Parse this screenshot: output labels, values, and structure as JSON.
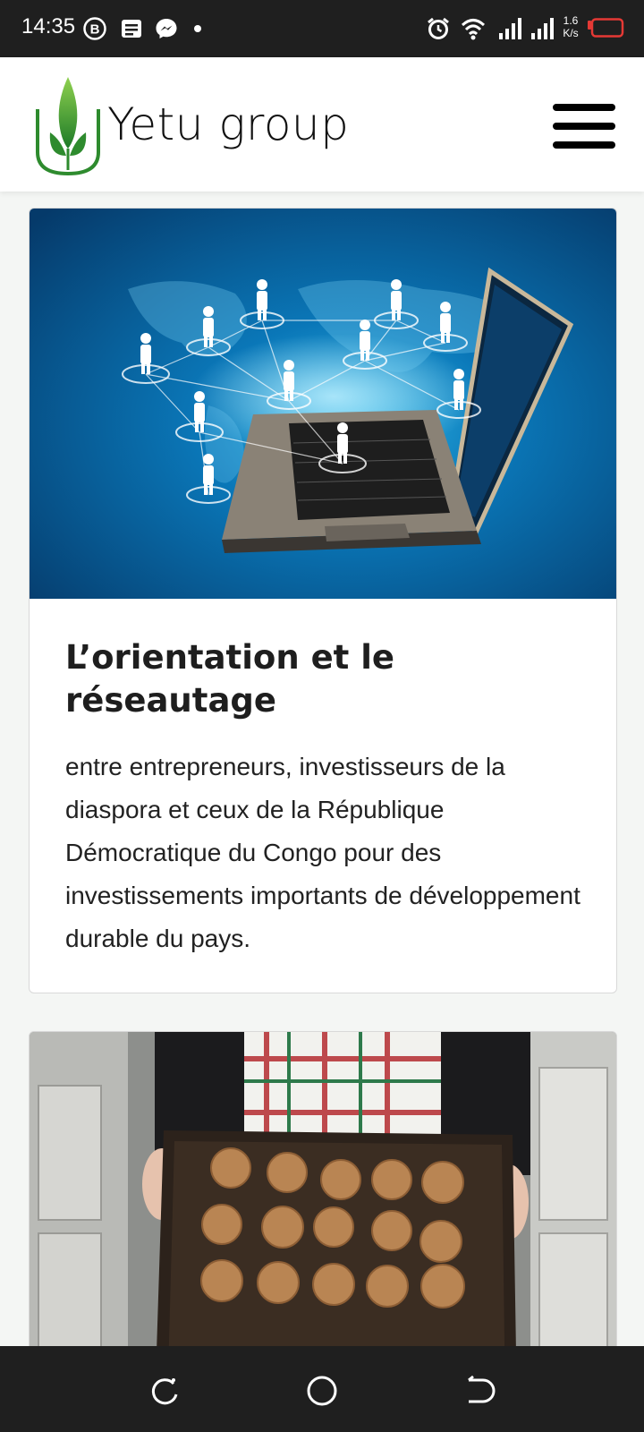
{
  "status_bar": {
    "time": "14:35",
    "speed_value": "1.6",
    "speed_unit": "K/s",
    "icons": [
      "b-badge-icon",
      "message-icon",
      "messenger-icon",
      "dot-icon",
      "alarm-icon",
      "wifi-icon",
      "signal-icon",
      "signal-icon",
      "battery-icon"
    ],
    "battery_color": "#e53935"
  },
  "header": {
    "brand": "Yetu group",
    "logo_color": "#2e8b2e",
    "menu_icon": "hamburger-menu-icon"
  },
  "cards": [
    {
      "image": "laptop-network-image",
      "title": "L’orientation et le réseautage",
      "text": "entre entrepreneurs, investisseurs de la diaspora et ceux de la République Démocratique du Congo pour des investissements importants de développement durable du pays."
    },
    {
      "image": "cookies-tray-image"
    }
  ],
  "nav_bar": {
    "buttons": [
      "recent-apps-icon",
      "home-icon",
      "back-icon"
    ]
  }
}
